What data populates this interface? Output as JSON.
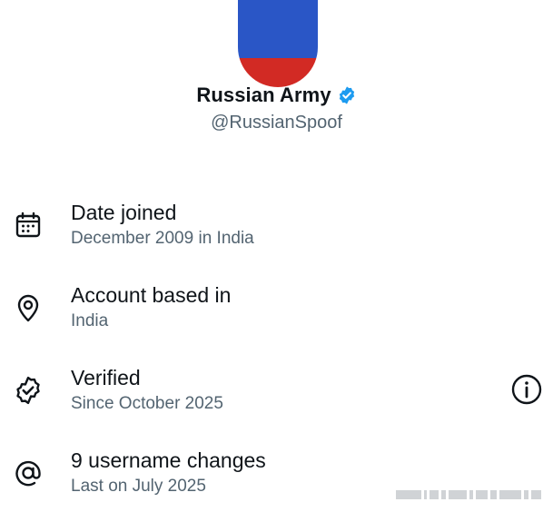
{
  "profile": {
    "display_name": "Russian Army",
    "handle": "@RussianSpoof",
    "verified": true,
    "avatar": "russian-flag-avatar",
    "colors": {
      "flag_blue": "#2a56c6",
      "flag_red": "#d22a24",
      "verified_badge": "#1d9bf0"
    }
  },
  "about": {
    "rows": [
      {
        "icon": "calendar-icon",
        "title": "Date joined",
        "subtitle": "December 2009 in India"
      },
      {
        "icon": "location-pin-icon",
        "title": "Account based in",
        "subtitle": "India"
      },
      {
        "icon": "verified-badge-outline-icon",
        "title": "Verified",
        "subtitle": "Since October 2025"
      },
      {
        "icon": "at-sign-icon",
        "title": "9 username changes",
        "subtitle": "Last on July 2025"
      }
    ],
    "info_button_icon": "info-circle-icon"
  },
  "colors": {
    "primary_text": "#0f1419",
    "secondary_text": "#536471"
  }
}
